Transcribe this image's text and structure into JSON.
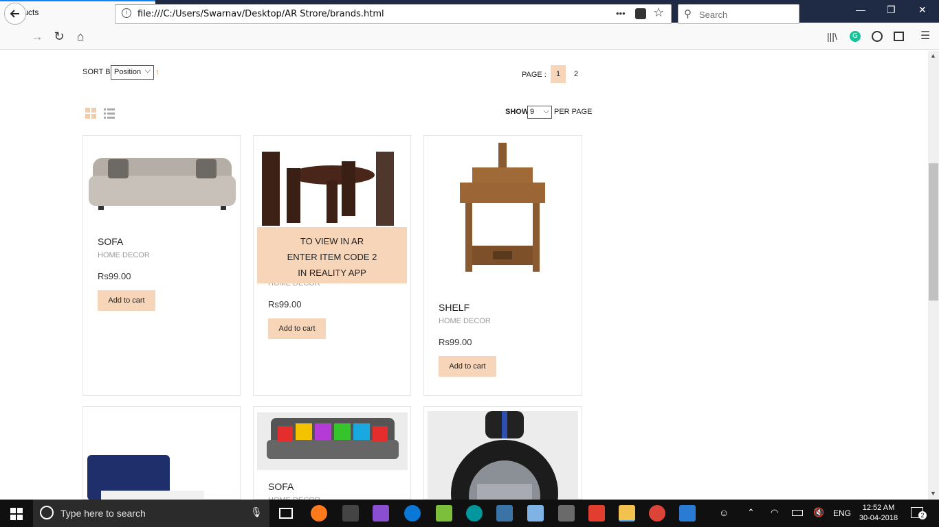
{
  "browser": {
    "tab_title": "Products",
    "url": "file:///C:/Users/Swarnav/Desktop/AR Strore/brands.html",
    "search_placeholder": "Search",
    "more_glyph": "•••"
  },
  "toolbar": {
    "sort_label": "SORT BY",
    "sort_value": "Position",
    "page_label": "PAGE :",
    "pages": [
      "1",
      "2"
    ],
    "show_label": "SHOW",
    "show_value": "9",
    "per_page_label": "PER PAGE"
  },
  "products": [
    {
      "name": "SOFA",
      "category": "HOME DECOR",
      "price": "Rs99.00",
      "button": "Add to cart"
    },
    {
      "name": "",
      "category": "HOME DECOR",
      "price": "Rs99.00",
      "button": "Add to cart",
      "overlay": [
        "TO VIEW IN AR",
        "ENTER ITEM CODE 2",
        "IN REALITY APP"
      ]
    },
    {
      "name": "SHELF",
      "category": "HOME DECOR",
      "price": "Rs99.00",
      "button": "Add to cart"
    },
    {
      "name": "",
      "category": "",
      "price": "",
      "button": ""
    },
    {
      "name": "SOFA",
      "category": "HOME DECOR",
      "price": "",
      "button": ""
    },
    {
      "name": "",
      "category": "",
      "price": "",
      "button": ""
    }
  ],
  "taskbar": {
    "search_placeholder": "Type here to search",
    "lang": "ENG",
    "time": "12:52 AM",
    "date": "30-04-2018",
    "notification_count": "2"
  },
  "colors": {
    "accent": "#f7d5b9",
    "titlebar": "#1f2a44",
    "taskbar": "#101010"
  }
}
